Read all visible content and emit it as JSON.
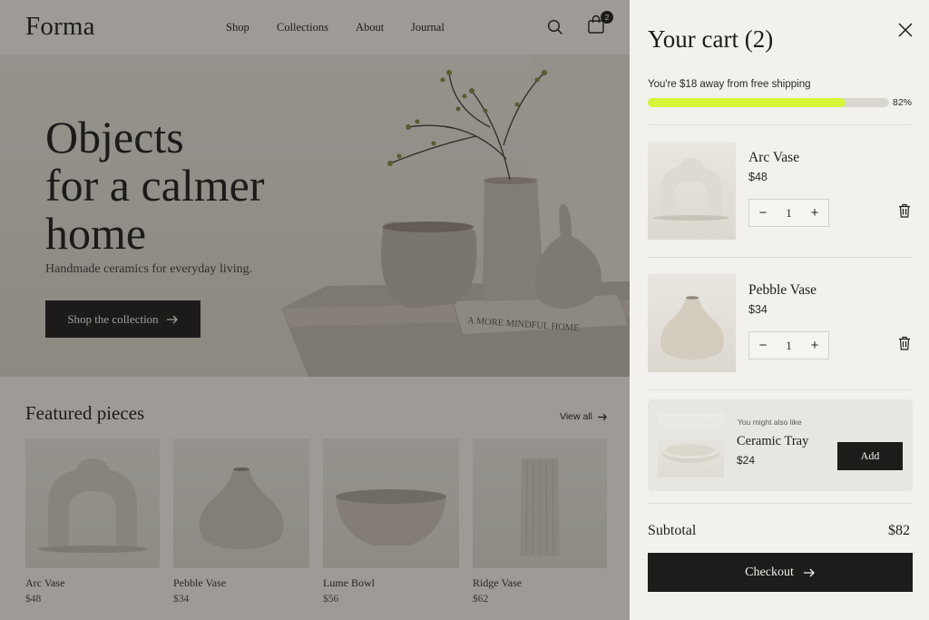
{
  "brand": {
    "logo": "Forma"
  },
  "nav": {
    "items": [
      "Shop",
      "Collections",
      "About",
      "Journal"
    ],
    "cart_count": "2"
  },
  "hero": {
    "title_lines": [
      "Objects",
      "for a calmer",
      "home"
    ],
    "subtitle": "Handmade ceramics for everyday living.",
    "cta": "Shop the collection",
    "book_text": "A MORE MINDFUL HOME"
  },
  "featured": {
    "title": "Featured pieces",
    "view_all": "View all",
    "products": [
      {
        "name": "Arc Vase",
        "price": "$48"
      },
      {
        "name": "Pebble Vase",
        "price": "$34"
      },
      {
        "name": "Lume Bowl",
        "price": "$56"
      },
      {
        "name": "Ridge Vase",
        "price": "$62"
      }
    ]
  },
  "cart": {
    "title": "Your cart (2)",
    "shipping_message": "You're $18 away from free shipping",
    "progress": {
      "value": 0.82,
      "label": "82%",
      "color": "#d6f53a"
    },
    "items": [
      {
        "name": "Arc Vase",
        "price": "$48",
        "qty": "1"
      },
      {
        "name": "Pebble Vase",
        "price": "$34",
        "qty": "1"
      }
    ],
    "upsell": {
      "kicker": "You might also like",
      "name": "Ceramic Tray",
      "price": "$24",
      "button": "Add"
    },
    "subtotal_label": "Subtotal",
    "subtotal_value": "$82",
    "checkout": "Checkout"
  },
  "colors": {
    "ink": "#1d1c1a",
    "accent": "#d6f53a",
    "panel": "#f3f1ec"
  },
  "icons": [
    "search-icon",
    "bag-icon",
    "close-icon",
    "trash-icon",
    "arrow-right-icon",
    "minus-icon",
    "plus-icon"
  ]
}
